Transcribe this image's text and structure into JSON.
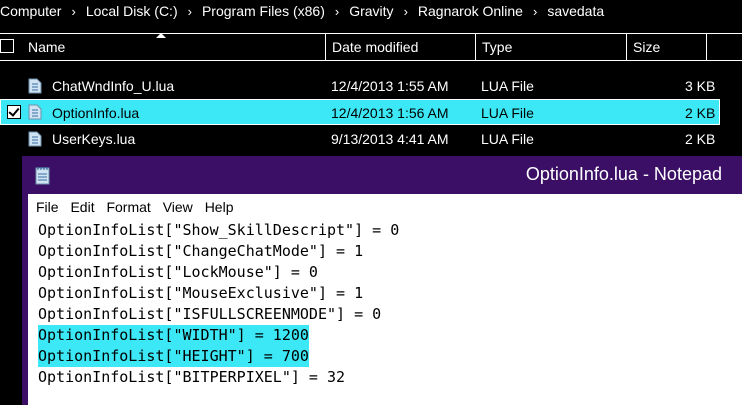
{
  "breadcrumb": [
    "Computer",
    "Local Disk (C:)",
    "Program Files (x86)",
    "Gravity",
    "Ragnarok Online",
    "savedata"
  ],
  "columns": {
    "name": "Name",
    "date": "Date modified",
    "type": "Type",
    "size": "Size"
  },
  "files": [
    {
      "name": "ChatWndInfo_U.lua",
      "date": "12/4/2013 1:55 AM",
      "type": "LUA File",
      "size": "3 KB",
      "selected": false
    },
    {
      "name": "OptionInfo.lua",
      "date": "12/4/2013 1:56 AM",
      "type": "LUA File",
      "size": "2 KB",
      "selected": true
    },
    {
      "name": "UserKeys.lua",
      "date": "9/13/2013 4:41 AM",
      "type": "LUA File",
      "size": "2 KB",
      "selected": false
    }
  ],
  "notepad": {
    "title": "OptionInfo.lua - Notepad",
    "menu": [
      "File",
      "Edit",
      "Format",
      "View",
      "Help"
    ],
    "lines": [
      "OptionInfoList[\"Show_SkillDescript\"] = 0",
      "OptionInfoList[\"ChangeChatMode\"] = 1",
      "OptionInfoList[\"LockMouse\"] = 0",
      "OptionInfoList[\"MouseExclusive\"] = 1",
      "OptionInfoList[\"ISFULLSCREENMODE\"] = 0",
      "OptionInfoList[\"WIDTH\"] = 1200",
      "OptionInfoList[\"HEIGHT\"] = 700",
      "OptionInfoList[\"BITPERPIXEL\"] = 32"
    ],
    "highlighted_lines": [
      5,
      6
    ]
  },
  "colors": {
    "selection": "#3ce8f6",
    "titlebar": "#3b0f66",
    "background": "#000000"
  }
}
